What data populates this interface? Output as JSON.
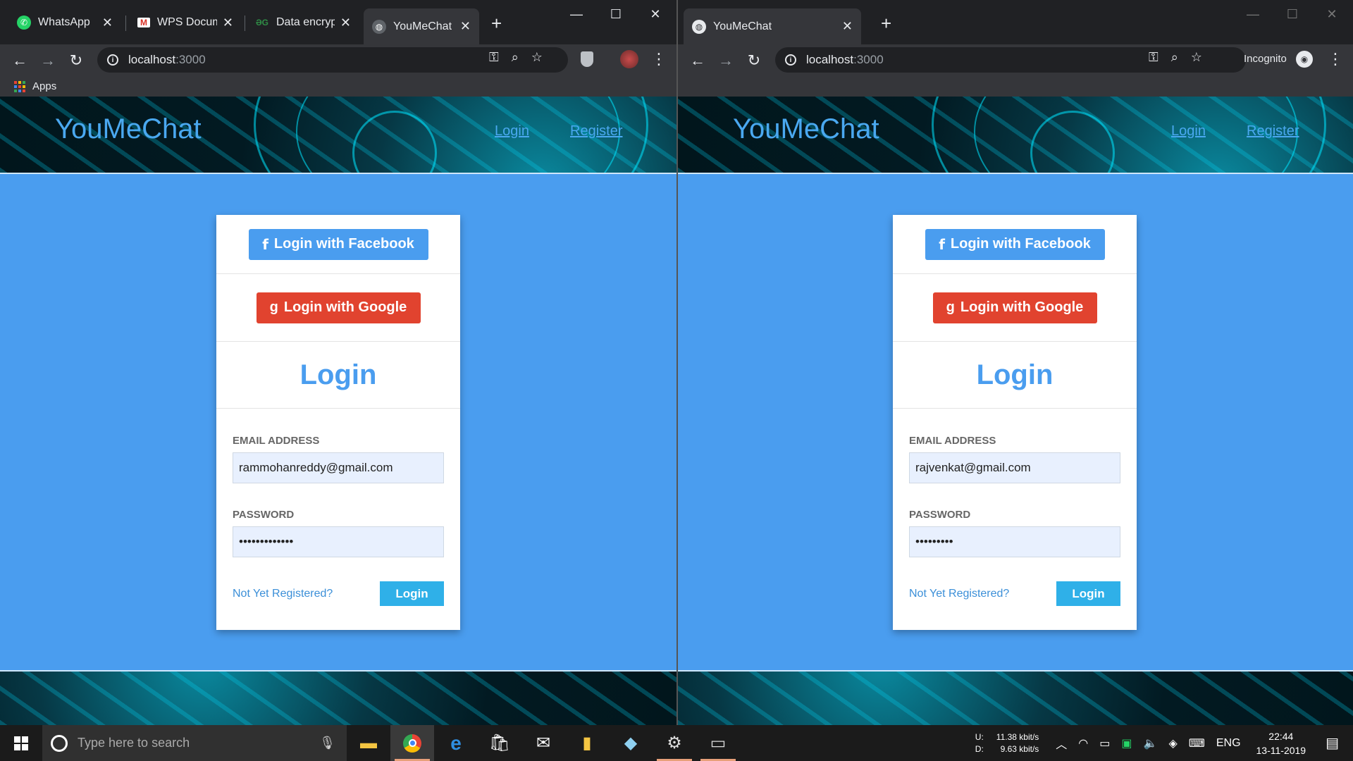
{
  "left_browser": {
    "tabs": [
      {
        "title": "WhatsApp",
        "favicon": "whatsapp-icon",
        "color": "#25d366"
      },
      {
        "title": "WPS Docume",
        "favicon": "gmail-icon",
        "color": "#d93025"
      },
      {
        "title": "Data encrypt",
        "favicon": "gfg-icon",
        "color": "#2f8d46"
      },
      {
        "title": "YouMeChat",
        "favicon": "globe-icon",
        "color": "#9aa0a6"
      }
    ],
    "url_host": "localhost",
    "url_port": ":3000",
    "bookmarks_apps": "Apps"
  },
  "right_browser": {
    "tabs": [
      {
        "title": "YouMeChat",
        "favicon": "globe-icon",
        "color": "#e8eaed"
      }
    ],
    "url_host": "localhost",
    "url_port": ":3000",
    "profile_label": "Incognito"
  },
  "site": {
    "brand": "YouMeChat",
    "nav_login": "Login",
    "nav_register": "Register",
    "fb_button": "Login with Facebook",
    "google_button": "Login with Google",
    "login_title": "Login",
    "email_label": "EMAIL ADDRESS",
    "password_label": "PASSWORD",
    "register_link": "Not Yet Registered?",
    "login_button": "Login"
  },
  "left_form": {
    "email": "rammohanreddy@gmail.com",
    "password": "•••••••••••••"
  },
  "right_form": {
    "email": "rajvenkat@gmail.com",
    "password": "•••••••••"
  },
  "taskbar": {
    "search_placeholder": "Type here to search",
    "net_up_label": "U:",
    "net_down_label": "D:",
    "net_up": "11.38 kbit/s",
    "net_down": "9.63 kbit/s",
    "language": "ENG",
    "time": "22:44",
    "date": "13-11-2019"
  }
}
